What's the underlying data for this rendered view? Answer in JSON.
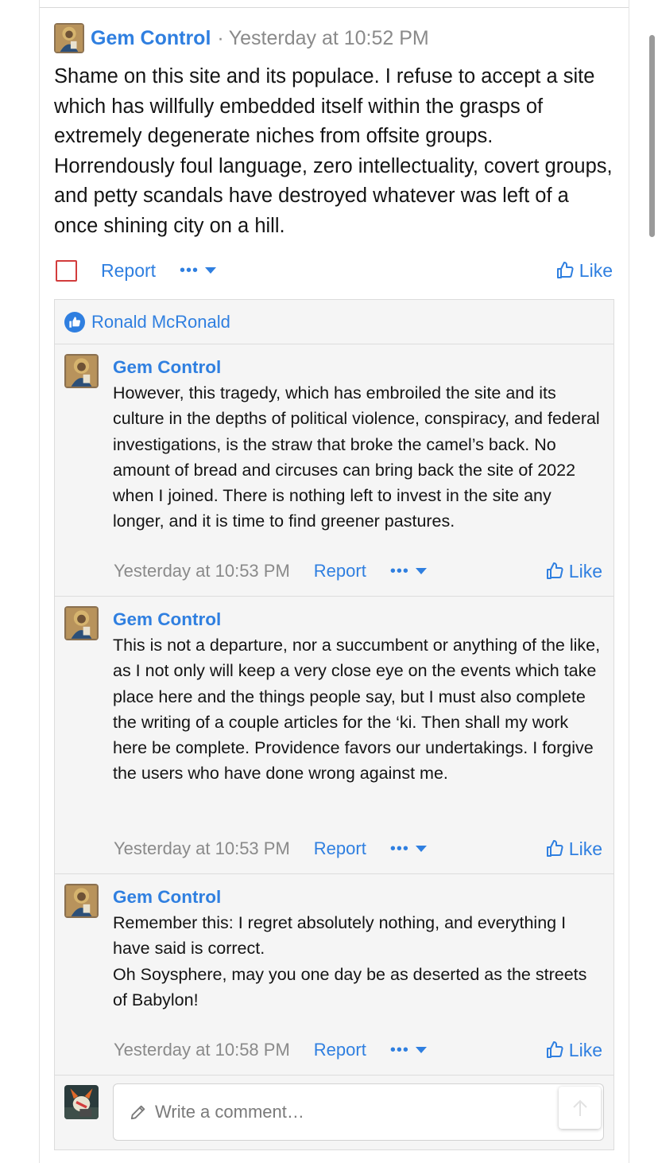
{
  "post": {
    "author": "Gem Control",
    "separator": "·",
    "timestamp": "Yesterday at 10:52 PM",
    "body": "Shame on this site and its populace. I refuse to accept a site which has willfully embedded itself within the grasps of extremely degenerate niches from offsite groups. Horrendously foul language, zero intellectuality, covert groups, and petty scandals have destroyed whatever was left of a once shining city on a hill.",
    "report_label": "Report",
    "more_label": "•••",
    "like_label": "Like"
  },
  "likes": {
    "liker": "Ronald McRonald"
  },
  "comments": [
    {
      "author": "Gem Control",
      "text": "However, this tragedy, which has embroiled the site and its culture in the depths of political violence, conspiracy, and federal investigations, is the straw that broke the camel’s back. No amount of bread and circuses can bring back the site of 2022 when I joined. There is nothing left to invest in the site any longer, and it is time to find greener pastures.",
      "timestamp": "Yesterday at 10:53 PM",
      "report_label": "Report",
      "more_label": "•••",
      "like_label": "Like"
    },
    {
      "author": "Gem Control",
      "text": "This is not a departure, nor a succumbent or anything of the like, as I not only will keep a very close eye on the events which take place here and the things people say, but I must also complete the writing of a couple articles for the ‘ki. Then shall my work here be complete. Providence favors our undertakings. I forgive the users who have done wrong against me.",
      "timestamp": "Yesterday at 10:53 PM",
      "report_label": "Report",
      "more_label": "•••",
      "like_label": "Like"
    },
    {
      "author": "Gem Control",
      "text": "Remember this: I regret absolutely nothing, and everything I have said is correct.\nOh Soysphere, may you one day be as deserted as the streets of Babylon!",
      "timestamp": "Yesterday at 10:58 PM",
      "report_label": "Report",
      "more_label": "•••",
      "like_label": "Like"
    }
  ],
  "comment_box": {
    "placeholder": "Write a comment…"
  },
  "colors": {
    "link": "#2f7fe0",
    "muted": "#8a8a8a",
    "checkbox": "#d23c3c",
    "panel": "#f5f5f5"
  },
  "icons": {
    "avatar": "mosaic-portrait-avatar",
    "current_user_avatar": "cartoon-avatar",
    "like": "thumbs-up-icon",
    "pencil": "pencil-icon",
    "scroll_top": "arrow-up-icon"
  }
}
